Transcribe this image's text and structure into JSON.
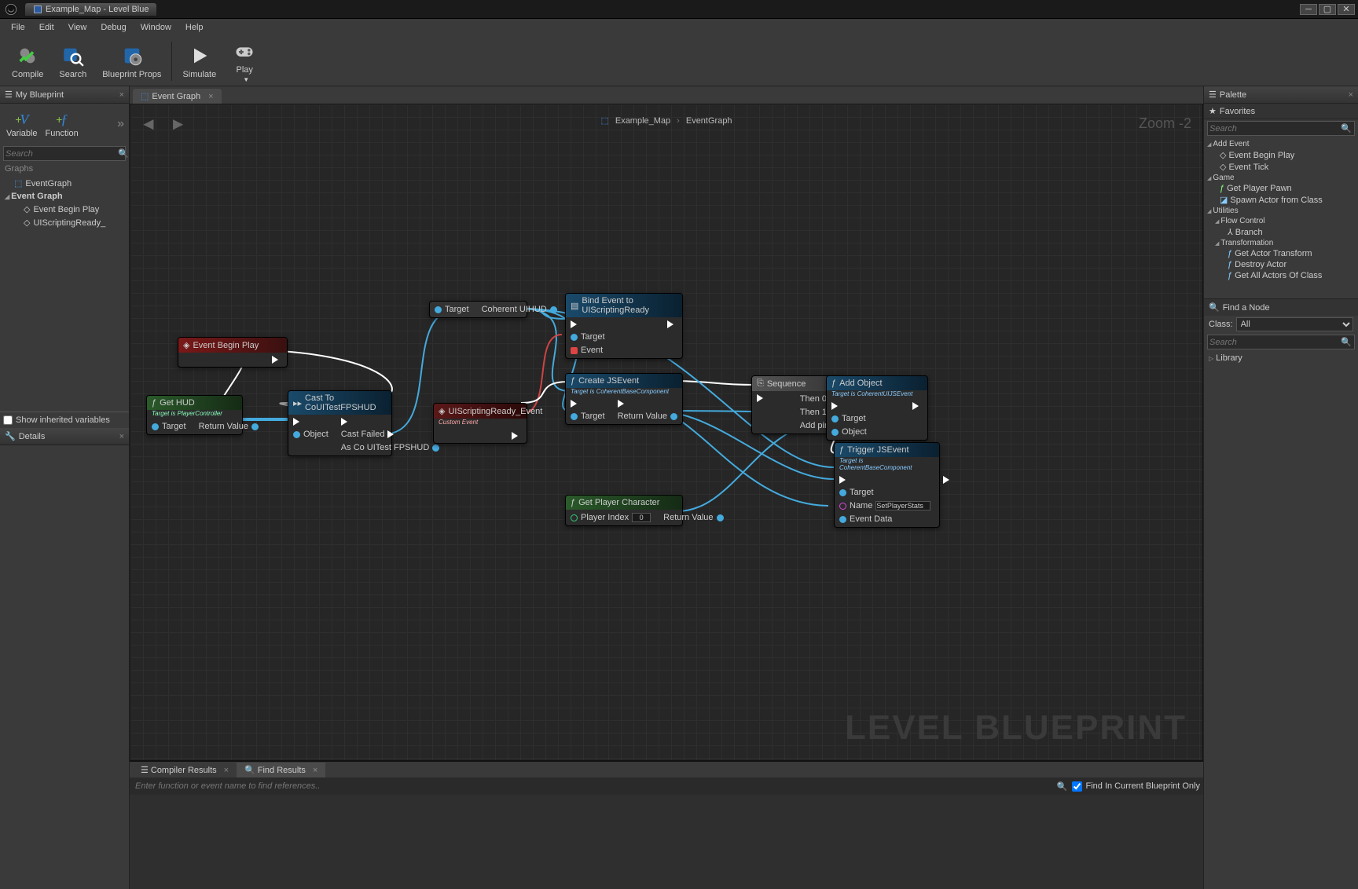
{
  "window": {
    "title": "Example_Map - Level Blue"
  },
  "menu": [
    "File",
    "Edit",
    "View",
    "Debug",
    "Window",
    "Help"
  ],
  "toolbar": [
    {
      "label": "Compile"
    },
    {
      "label": "Search"
    },
    {
      "label": "Blueprint Props"
    },
    {
      "label": "Simulate"
    },
    {
      "label": "Play"
    }
  ],
  "left": {
    "panel_title": "My Blueprint",
    "var_btn": "Variable",
    "fn_btn": "Function",
    "search_ph": "Search",
    "graphs_label": "Graphs",
    "tree": {
      "root": "EventGraph",
      "cat": "Event Graph",
      "items": [
        "Event Begin Play",
        "UIScriptingReady_"
      ]
    },
    "show_inherited": "Show inherited variables",
    "details": "Details"
  },
  "graph": {
    "tab": "Event Graph",
    "crumb_map": "Example_Map",
    "crumb_graph": "EventGraph",
    "zoom": "Zoom -2",
    "watermark": "LEVEL BLUEPRINT",
    "nodes": {
      "begin": {
        "title": "Event Begin Play"
      },
      "gethud": {
        "title": "Get HUD",
        "sub": "Target is PlayerController",
        "target": "Target",
        "rv": "Return Value"
      },
      "cast": {
        "title": "Cast To CoUITestFPSHUD",
        "obj": "Object",
        "fail": "Cast Failed",
        "asco": "As Co UITest FPSHUD"
      },
      "tgt": {
        "target": "Target",
        "coh": "Coherent UIHUD"
      },
      "uiready": {
        "title": "UIScriptingReady_Event",
        "sub": "Custom Event"
      },
      "bind": {
        "title": "Bind Event to UIScriptingReady",
        "target": "Target",
        "event": "Event"
      },
      "createjs": {
        "title": "Create JSEvent",
        "sub": "Target is CoherentBaseComponent",
        "target": "Target",
        "rv": "Return Value"
      },
      "seq": {
        "title": "Sequence",
        "then0": "Then 0",
        "then1": "Then 1",
        "addpin": "Add pin"
      },
      "addobj": {
        "title": "Add Object",
        "sub": "Target is CoherentUIJSEvent",
        "target": "Target",
        "obj": "Object"
      },
      "getpc": {
        "title": "Get Player Character",
        "pidx": "Player Index",
        "pval": "0",
        "rv": "Return Value"
      },
      "trigger": {
        "title": "Trigger JSEvent",
        "sub": "Target is CoherentBaseComponent",
        "target": "Target",
        "name": "Name",
        "nameval": "SetPlayerStats",
        "evdata": "Event Data"
      }
    }
  },
  "bottom": {
    "compiler": "Compiler Results",
    "find": "Find Results",
    "find_ph": "Enter function or event name to find references..",
    "find_cb": "Find In Current Blueprint Only"
  },
  "right": {
    "panel": "Palette",
    "fav": "Favorites",
    "search_ph": "Search",
    "tree": {
      "addevent": "Add Event",
      "addevent_items": [
        "Event Begin Play",
        "Event Tick"
      ],
      "game": "Game",
      "game_items": [
        "Get Player Pawn",
        "Spawn Actor from Class"
      ],
      "util": "Utilities",
      "flow": "Flow Control",
      "flow_items": [
        "Branch"
      ],
      "trans": "Transformation",
      "trans_items": [
        "Get Actor Transform",
        "Destroy Actor",
        "Get All Actors Of Class"
      ]
    },
    "findnode": "Find a Node",
    "class": "Class:",
    "class_val": "All",
    "search2_ph": "Search",
    "library": "Library"
  }
}
